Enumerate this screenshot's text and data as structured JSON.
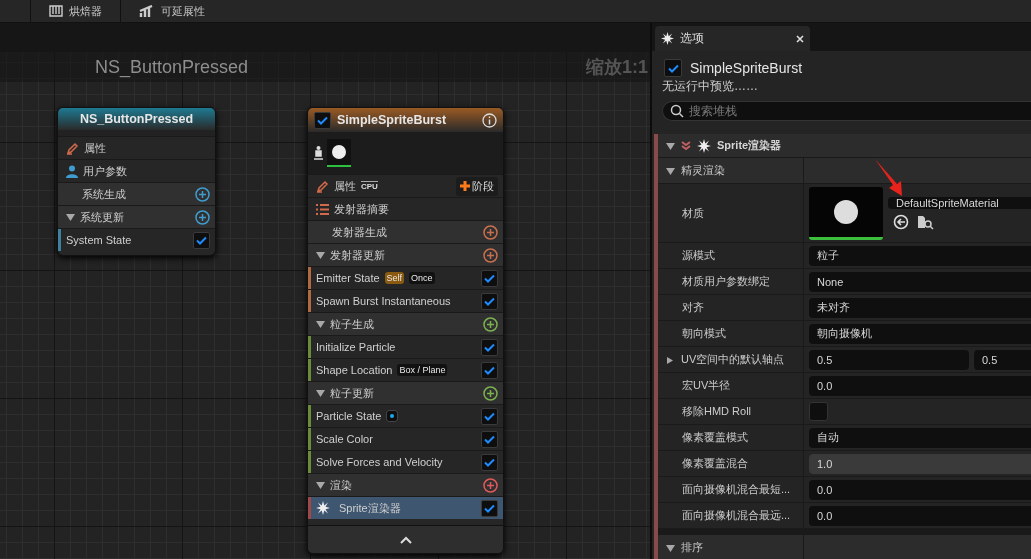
{
  "toolbar": {
    "items": [
      {
        "kind": "baker",
        "label": "烘焙器"
      },
      {
        "kind": "scalability",
        "label": "可延展性"
      }
    ]
  },
  "graph": {
    "title": "NS_ButtonPressed",
    "zoom": "缩放1:1",
    "nodes": [
      {
        "kind": "system",
        "title": "NS_ButtonPressed",
        "color": "#1e7a92",
        "rows": [
          {
            "kind": "properties",
            "label": "属性"
          },
          {
            "kind": "user",
            "label": "用户参数"
          },
          {
            "kind": "section",
            "label": "系统生成",
            "color": "#3f9ccf"
          },
          {
            "kind": "group",
            "label": "系统更新",
            "color": "#3f9ccf",
            "expanded": true
          },
          {
            "kind": "module",
            "label": "System State",
            "checked": true,
            "selected": false,
            "color": "#3f7fa0",
            "badges": []
          }
        ]
      },
      {
        "kind": "emitter",
        "title": "SimpleSpriteBurst",
        "checked": true,
        "color": "#9a5a24",
        "rows": [
          {
            "kind": "properties",
            "label": "属性",
            "target": "CPU",
            "stage_button": "阶段"
          },
          {
            "kind": "summary",
            "label": "发射器摘要"
          },
          {
            "kind": "section",
            "label": "发射器生成",
            "color": "#c8704e"
          },
          {
            "kind": "group",
            "label": "发射器更新",
            "color": "#c8704e",
            "expanded": true
          },
          {
            "kind": "module",
            "label": "Emitter State",
            "checked": true,
            "selected": false,
            "color": "#b06a40",
            "badges": [
              {
                "kind": "text",
                "text": "Self",
                "color": "#8a5a10"
              },
              {
                "kind": "text",
                "text": "Once",
                "color": "#111111"
              }
            ]
          },
          {
            "kind": "module",
            "label": "Spawn Burst Instantaneous",
            "checked": true,
            "selected": false,
            "color": "#b06a40",
            "badges": []
          },
          {
            "kind": "group",
            "label": "粒子生成",
            "color": "#7bb14f",
            "expanded": true
          },
          {
            "kind": "module",
            "label": "Initialize Particle",
            "checked": true,
            "selected": false,
            "color": "#6a8a3c",
            "badges": []
          },
          {
            "kind": "module",
            "label": "Shape Location",
            "checked": true,
            "selected": false,
            "color": "#6a8a3c",
            "badges": [
              {
                "kind": "text",
                "text": "Box / Plane",
                "color": "#111111"
              }
            ]
          },
          {
            "kind": "group",
            "label": "粒子更新",
            "color": "#7bb14f",
            "expanded": true
          },
          {
            "kind": "module",
            "label": "Particle State",
            "checked": true,
            "selected": false,
            "color": "#6a8a3c",
            "badges": [
              {
                "kind": "dot",
                "color": "#18a8f0"
              }
            ]
          },
          {
            "kind": "module",
            "label": "Scale Color",
            "checked": true,
            "selected": false,
            "color": "#6a8a3c",
            "badges": []
          },
          {
            "kind": "module",
            "label": "Solve Forces and Velocity",
            "checked": true,
            "selected": false,
            "color": "#6a8a3c",
            "badges": []
          },
          {
            "kind": "group",
            "label": "渲染",
            "color": "#e05a5a",
            "expanded": true
          },
          {
            "kind": "renderer",
            "label": "Sprite渲染器",
            "checked": true,
            "selected": true,
            "color": "#a04848",
            "badges": []
          }
        ]
      }
    ]
  },
  "panel": {
    "tab": "选项",
    "emitter": {
      "checked": true,
      "name": "SimpleSpriteBurst"
    },
    "status": "无运行中预览……",
    "search": {
      "placeholder": "搜索堆栈"
    },
    "section": {
      "label": "Sprite渲染器",
      "expanded": true
    },
    "groups": [
      {
        "label": "精灵渲染",
        "expanded": true,
        "properties": [
          {
            "kind": "material",
            "label": "材质",
            "value": "DefaultSpriteMaterial"
          },
          {
            "kind": "dropdown",
            "label": "源模式",
            "value": "粒子"
          },
          {
            "kind": "dropdown",
            "label": "材质用户参数绑定",
            "value": "None"
          },
          {
            "kind": "dropdown",
            "label": "对齐",
            "value": "未对齐"
          },
          {
            "kind": "dropdown",
            "label": "朝向模式",
            "value": "朝向摄像机"
          },
          {
            "kind": "vector",
            "label": "UV空间中的默认轴点",
            "expanded": false,
            "values": [
              "0.5",
              "0.5"
            ]
          },
          {
            "kind": "number",
            "label": "宏UV半径",
            "value": "0.0"
          },
          {
            "kind": "checkbox",
            "label": "移除HMD Roll",
            "checked": false
          },
          {
            "kind": "dropdown",
            "label": "像素覆盖模式",
            "value": "自动"
          },
          {
            "kind": "slider",
            "label": "像素覆盖混合",
            "value": "1.0",
            "level": 1
          },
          {
            "kind": "number",
            "label": "面向摄像机混合最短...",
            "value": "0.0"
          },
          {
            "kind": "number",
            "label": "面向摄像机混合最远...",
            "value": "0.0"
          }
        ]
      },
      {
        "label": "排序",
        "expanded": true
      }
    ]
  }
}
